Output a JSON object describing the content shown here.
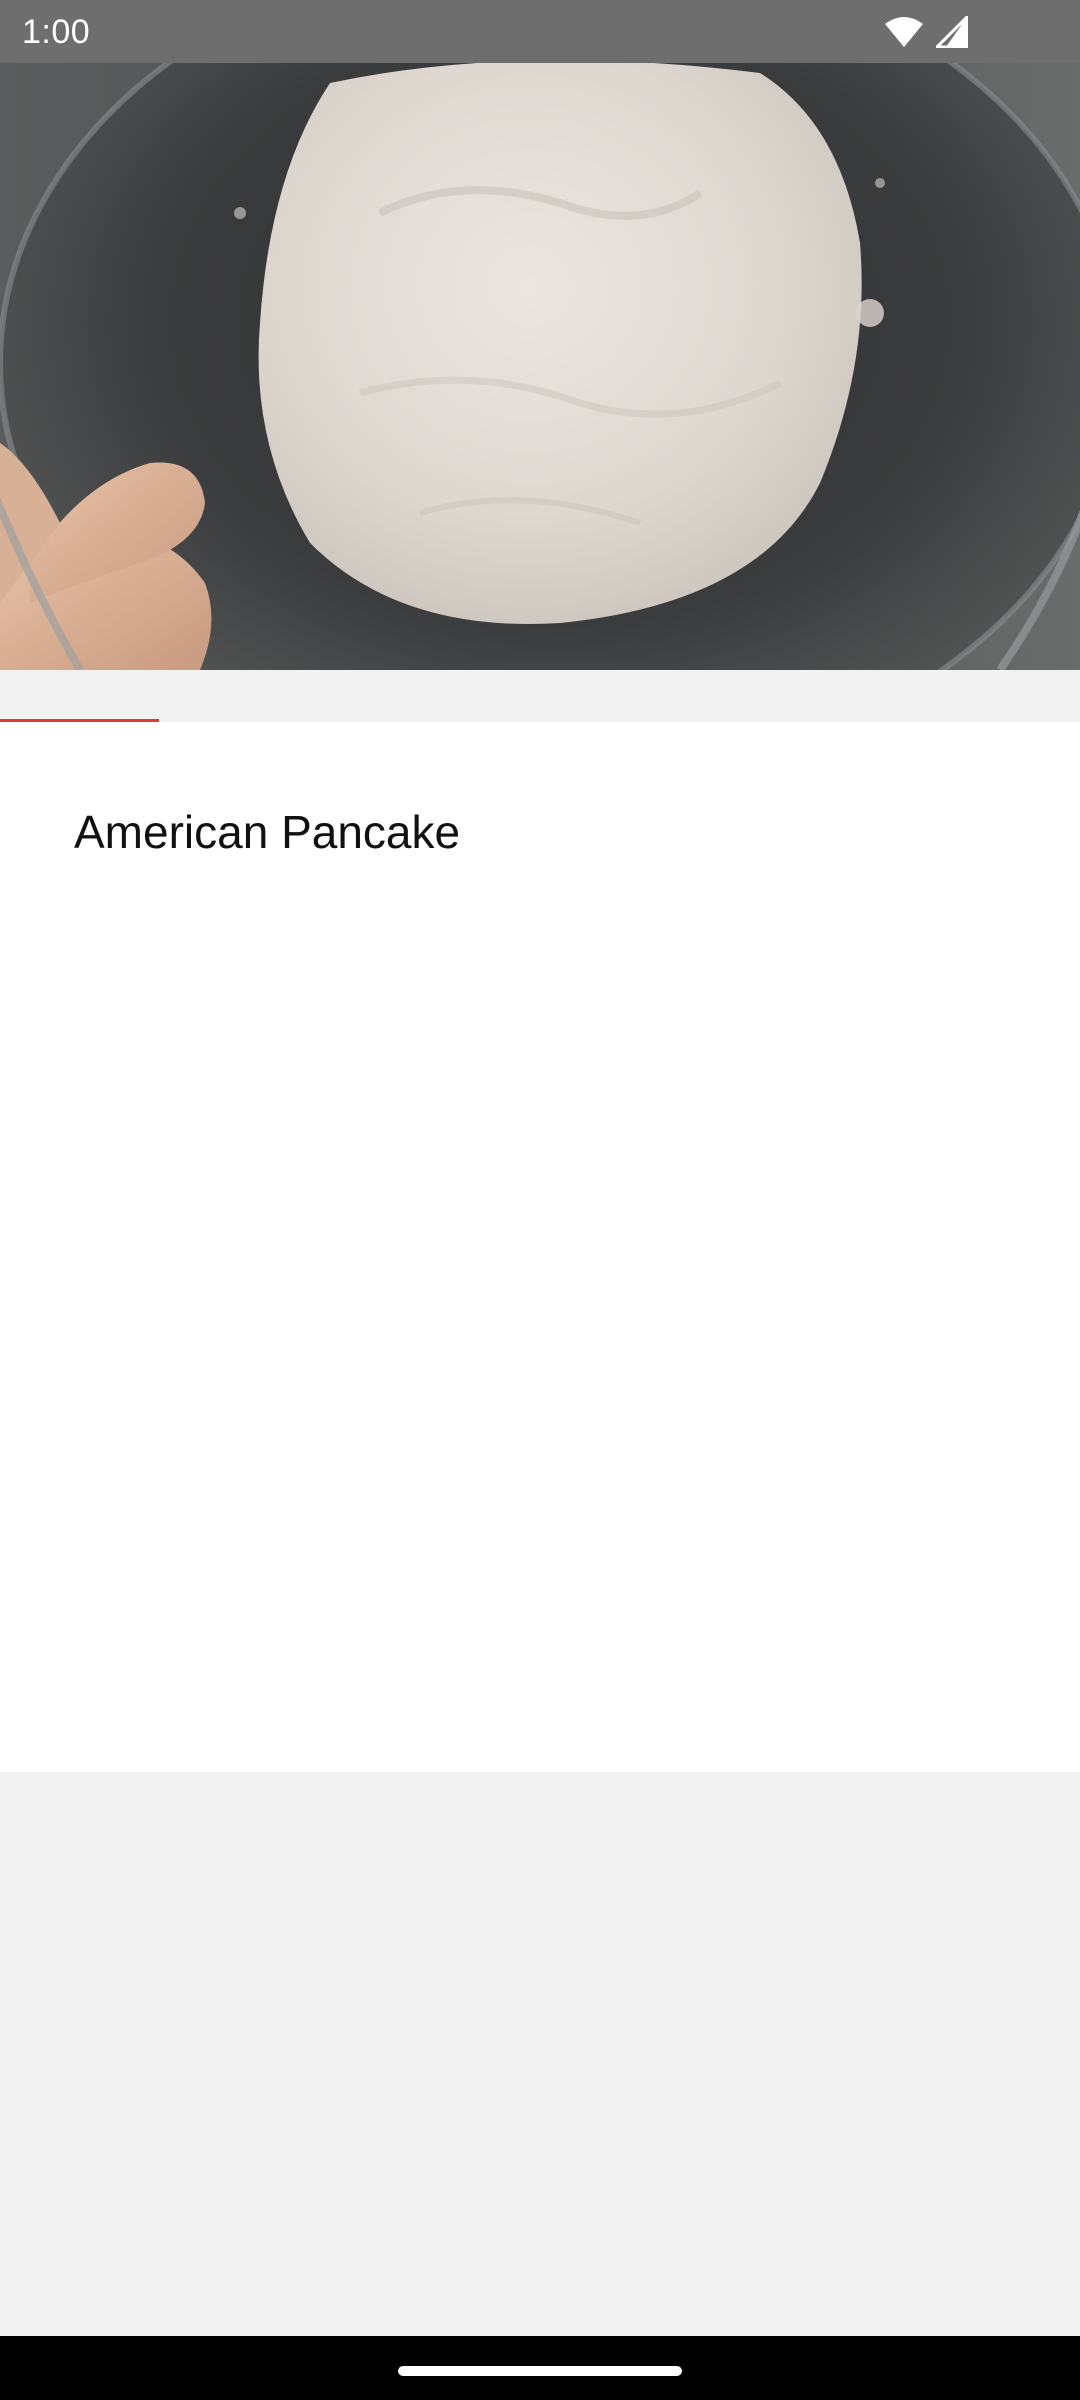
{
  "status_bar": {
    "time": "1:00",
    "icons": [
      "wifi-icon",
      "cell-signal-icon"
    ],
    "background": "#6e6e6e"
  },
  "video": {
    "description_icon": "video-frame",
    "progress": 0.147,
    "progress_color": "#e53935"
  },
  "recipe": {
    "title": "American Pancake"
  },
  "nav": {
    "handle": "home-handle"
  }
}
